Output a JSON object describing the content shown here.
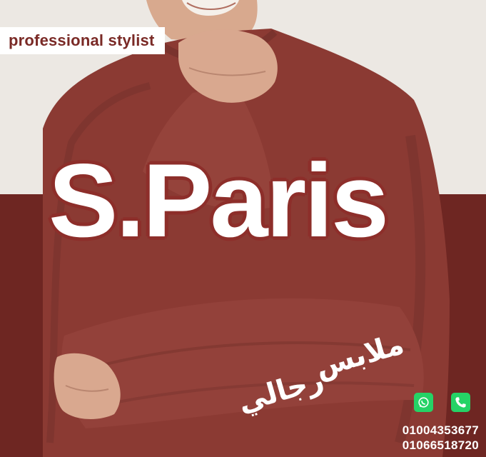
{
  "badge": {
    "text": "professional stylist"
  },
  "logo": {
    "text": "S.Paris"
  },
  "tagline": {
    "line1": "ملابس",
    "line2": "رجالي"
  },
  "contact": {
    "icons": [
      "whatsapp-icon",
      "phone-icon"
    ],
    "phones": [
      "01004353677",
      "01066518720"
    ]
  },
  "colors": {
    "background_light": "#ece8e3",
    "background_dark": "#6e2622",
    "sweater": "#8b3a33",
    "accent_text": "#7a2a26",
    "icon_green": "#25d366"
  }
}
